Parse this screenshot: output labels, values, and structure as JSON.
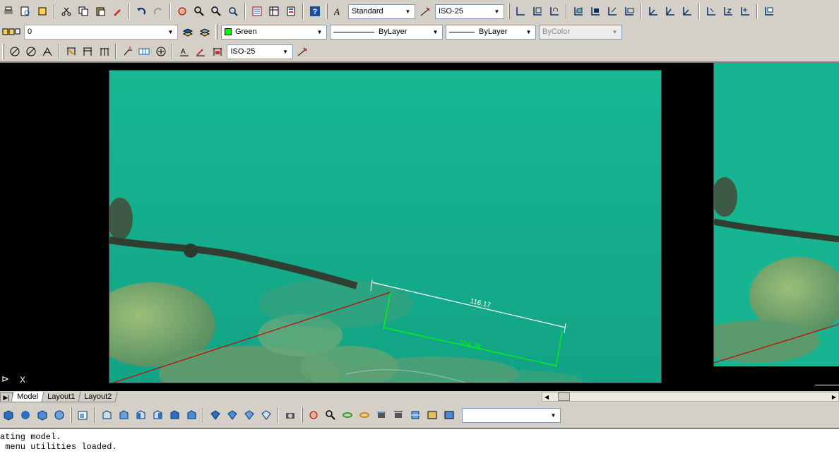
{
  "toolbar_standard": {
    "icons": [
      "plot-icon",
      "plot-preview-icon",
      "publish-icon",
      "cut-icon",
      "copy-icon",
      "paste-icon",
      "match-properties-icon",
      "undo-icon",
      "redo-icon",
      "pan-icon",
      "zoom-realtime-icon",
      "zoom-window-icon",
      "zoom-previous-icon",
      "properties-icon",
      "design-center-icon",
      "tool-palettes-icon",
      "help-icon"
    ]
  },
  "styles": {
    "text_style": "Standard",
    "dim_style": "ISO-25"
  },
  "layers": {
    "current_layer": "0",
    "color": "Green",
    "color_hex": "#00ff00",
    "linetype": "ByLayer",
    "lineweight": "ByLayer",
    "plot_style": "ByColor"
  },
  "dimension_toolbar": {
    "dim_style": "ISO-25"
  },
  "drawing": {
    "dimension_aligned": "116.17",
    "dimension_projected": "104.78"
  },
  "colors": {
    "dimension_white": "#ffffff",
    "dimension_green": "#00ff00",
    "red_line": "#cc0000"
  },
  "tabs": {
    "model": "Model",
    "layout1": "Layout1",
    "layout2": "Layout2"
  },
  "ucs": {
    "x_label": "X"
  },
  "command_line": {
    "line1": "ating model.",
    "line2": " menu utilities loaded."
  }
}
